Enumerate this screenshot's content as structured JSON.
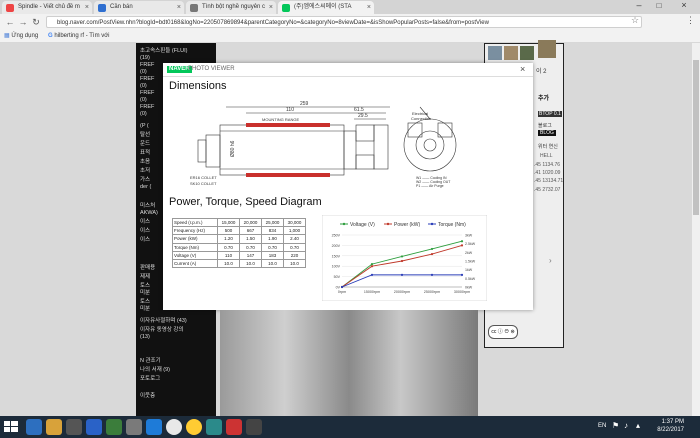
{
  "browser": {
    "tabs": [
      {
        "label": "Spindle - Viết chủ đề m",
        "icon_color": "#e44"
      },
      {
        "label": "Cần bán",
        "icon_color": "#2f6fd0"
      },
      {
        "label": "Tình bột nghề nguyên c",
        "icon_color": "#777"
      },
      {
        "label": "(주)엠에스씨메이 (STA",
        "icon_color": "#03c75a"
      }
    ],
    "url": "blog.naver.com/PostView.nhn?blogId=bdt0168&logNo=220507869894&parentCategoryNo=&categoryNo=8viewDate=&isShowPopularPosts=false&from=postView",
    "bookmarks": [
      "Ứng dụng",
      "hilberting rf - Tìm với"
    ]
  },
  "viewer": {
    "brand": "NAVER",
    "title": "PHOTO VIEWER",
    "close": "×"
  },
  "drawing": {
    "title": "Dimensions",
    "dim_top": "259",
    "dim_mid": "110",
    "dim_r1": "61.5",
    "dim_r2": "29.5",
    "mounting": "MOUNTING RANGE",
    "dia": "Ø80 h6",
    "collet1": "ER16 COLLET",
    "collet2": "SK10 COLLET",
    "connection": "Electrical\nConnection",
    "legend": [
      "W1 —— Cooling IN",
      "W2 —— Cooling OUT",
      "P1 —— Air Purge"
    ]
  },
  "section2": {
    "title": "Power, Torque, Speed Diagram"
  },
  "spec_table": {
    "rows": [
      {
        "label": "Speed (r.p.m.)",
        "values": [
          "15,000",
          "20,000",
          "25,000",
          "30,000"
        ]
      },
      {
        "label": "Frequency (Hz)",
        "values": [
          "500",
          "667",
          "834",
          "1,000"
        ]
      },
      {
        "label": "Power (kW)",
        "values": [
          "1.20",
          "1.50",
          "1.90",
          "2.40"
        ]
      },
      {
        "label": "Torque (Nm)",
        "values": [
          "0.70",
          "0.70",
          "0.70",
          "0.70"
        ]
      },
      {
        "label": "Voltage (V)",
        "values": [
          "110",
          "147",
          "183",
          "220"
        ]
      },
      {
        "label": "Current (A)",
        "values": [
          "10.0",
          "10.0",
          "10.0",
          "10.0"
        ]
      }
    ]
  },
  "chart_data": {
    "type": "line",
    "categories": [
      "0rpm",
      "15000rpm",
      "20000rpm",
      "25000rpm",
      "30000rpm"
    ],
    "series": [
      {
        "name": "Voltage (V)",
        "color": "#2e9e3e",
        "values": [
          0,
          110,
          147,
          183,
          220
        ]
      },
      {
        "name": "Power (kW)",
        "color": "#c0392b",
        "values": [
          0,
          1.2,
          1.5,
          1.9,
          2.4
        ]
      },
      {
        "name": "Torque (Nm)",
        "color": "#2a3db8",
        "values": [
          0,
          0.7,
          0.7,
          0.7,
          0.7
        ]
      }
    ],
    "y_left_ticks": [
      "250V",
      "200V",
      "150V",
      "100V",
      "50V",
      "0V"
    ],
    "y_right_ticks": [
      "3kW",
      "2.5kW",
      "2kW",
      "1.5kW",
      "1kW",
      "0.5kW",
      "0kW"
    ],
    "ylim_left": [
      0,
      250
    ],
    "ylim_right": [
      0,
      3
    ]
  },
  "left_sidebar": {
    "items": [
      "초고속스핀들 (FLUI)",
      "(19)",
      "FREF",
      "(0)",
      "FREF",
      "(0)",
      "FREF",
      "(0)",
      "FREF",
      "(0)",
      "(P (",
      "탈선",
      "운드",
      "표적",
      "초음",
      "초저",
      "가스",
      "der (",
      "미스처",
      "AKWA)",
      "이스",
      "이스",
      "이스",
      "판매용",
      "제제",
      "토스",
      "미분",
      "토스",
      "미분",
      "이자유사절하며 (43)",
      "이자유 동영상 강의",
      "(13)",
      "N 관조기",
      "나의 서재 (9)",
      "포토로그",
      "이웃층"
    ]
  },
  "right_sidebar": {
    "items": [
      "이 2",
      "추가",
      "BTOP 0.1",
      "블로그",
      "BLOG",
      "위터 연신",
      "HELL",
      ".45 1134.76",
      ".41 1020.09",
      ".45 13134.71",
      ".45 2732.07"
    ]
  },
  "taskbar": {
    "lang": "EN",
    "time": "1:37 PM",
    "date": "8/22/2017"
  }
}
